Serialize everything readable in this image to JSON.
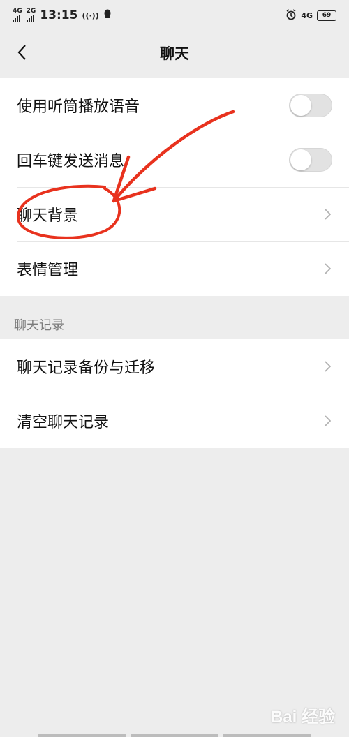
{
  "status_bar": {
    "signal1_label": "4G",
    "signal2_label": "2G",
    "time": "13:15",
    "right_network": "4G",
    "battery": "69"
  },
  "nav": {
    "title": "聊天"
  },
  "group1": {
    "items": [
      {
        "label": "使用听筒播放语音",
        "type": "switch",
        "on": false
      },
      {
        "label": "回车键发送消息",
        "type": "switch",
        "on": false
      },
      {
        "label": "聊天背景",
        "type": "link"
      },
      {
        "label": "表情管理",
        "type": "link"
      }
    ]
  },
  "section": {
    "header": "聊天记录"
  },
  "group2": {
    "items": [
      {
        "label": "聊天记录备份与迁移",
        "type": "link"
      },
      {
        "label": "清空聊天记录",
        "type": "link"
      }
    ]
  },
  "watermark": "Bai 经验",
  "colors": {
    "background": "#ededed",
    "annotation": "#e8321e",
    "switch_off": "#e2e2e2"
  }
}
